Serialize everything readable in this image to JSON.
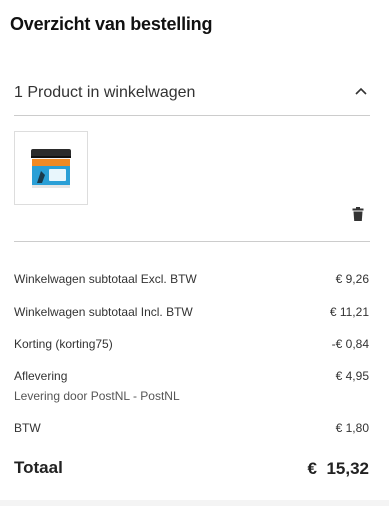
{
  "summary": {
    "title": "Overzicht van bestelling"
  },
  "cart": {
    "header_label": "1 Product in winkelwagen",
    "toggle_icon": "chevron-up-icon",
    "remove_icon": "trash-icon",
    "product_image_alt_icon": "product-jar-image"
  },
  "totals": {
    "rows": [
      {
        "label": "Winkelwagen subtotaal Excl. BTW",
        "value": "€ 9,26"
      },
      {
        "label": "Winkelwagen subtotaal Incl. BTW",
        "value": "€ 11,21"
      },
      {
        "label": "Korting (korting75)",
        "value": "-€ 0,84"
      },
      {
        "label": "Aflevering",
        "value": "€ 4,95",
        "sub": "Levering door PostNL - PostNL"
      },
      {
        "label": "BTW",
        "value": "€ 1,80"
      }
    ],
    "grand_total_label": "Totaal",
    "grand_total_value": "€  15,32"
  },
  "colors": {
    "text": "#333333",
    "divider": "#cccccc",
    "jar_orange": "#f08a24",
    "jar_blue": "#2a9fd6"
  }
}
